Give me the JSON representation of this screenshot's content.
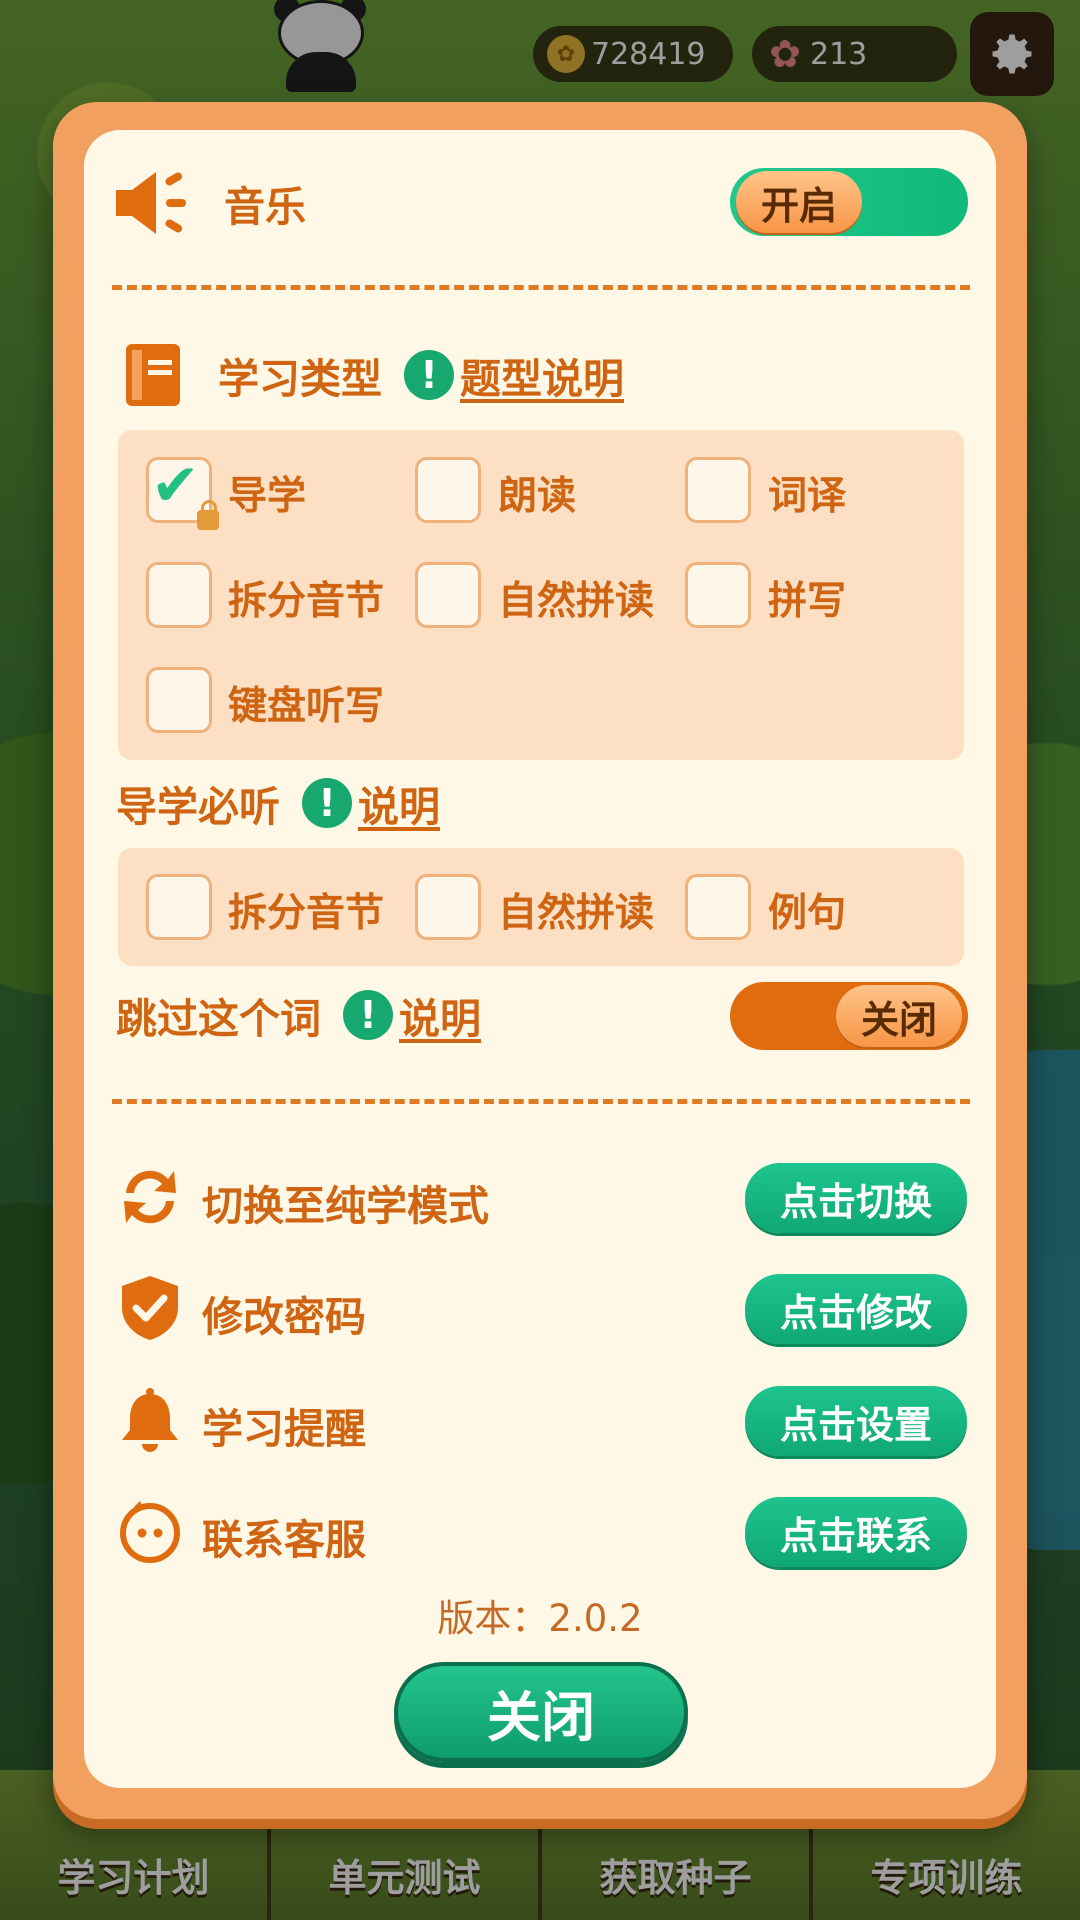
{
  "hud": {
    "coins": "728419",
    "stars": "213",
    "coin_icon": "coin-icon",
    "star_icon": "flower-icon",
    "settings_icon": "gear-icon"
  },
  "bottom_nav": [
    {
      "label": "学习计划"
    },
    {
      "label": "单元测试"
    },
    {
      "label": "获取种子"
    },
    {
      "label": "专项训练"
    }
  ],
  "modal": {
    "music": {
      "label": "音乐",
      "toggle_text": "开启",
      "state": "on"
    },
    "study_type": {
      "label": "学习类型",
      "help_link": "题型说明",
      "options": [
        {
          "label": "导学",
          "checked": true,
          "locked": true
        },
        {
          "label": "朗读",
          "checked": false
        },
        {
          "label": "词译",
          "checked": false
        },
        {
          "label": "拆分音节",
          "checked": false
        },
        {
          "label": "自然拼读",
          "checked": false
        },
        {
          "label": "拼写",
          "checked": false
        },
        {
          "label": "键盘听写",
          "checked": false
        }
      ]
    },
    "guide_listen": {
      "label": "导学必听",
      "help_link": "说明",
      "options": [
        {
          "label": "拆分音节",
          "checked": false
        },
        {
          "label": "自然拼读",
          "checked": false
        },
        {
          "label": "例句",
          "checked": false
        }
      ]
    },
    "skip_word": {
      "label": "跳过这个词",
      "help_link": "说明",
      "toggle_text": "关闭",
      "state": "off"
    },
    "actions": [
      {
        "label": "切换至纯学模式",
        "button": "点击切换",
        "icon": "refresh-icon"
      },
      {
        "label": "修改密码",
        "button": "点击修改",
        "icon": "shield-check-icon"
      },
      {
        "label": "学习提醒",
        "button": "点击设置",
        "icon": "bell-icon"
      },
      {
        "label": "联系客服",
        "button": "点击联系",
        "icon": "customer-service-icon"
      }
    ],
    "version": "版本：2.0.2",
    "close_label": "关闭"
  },
  "colors": {
    "accent_orange": "#cf6412",
    "accent_green": "#17a870",
    "panel_bg": "#fff8e6",
    "frame": "#f2a060"
  }
}
